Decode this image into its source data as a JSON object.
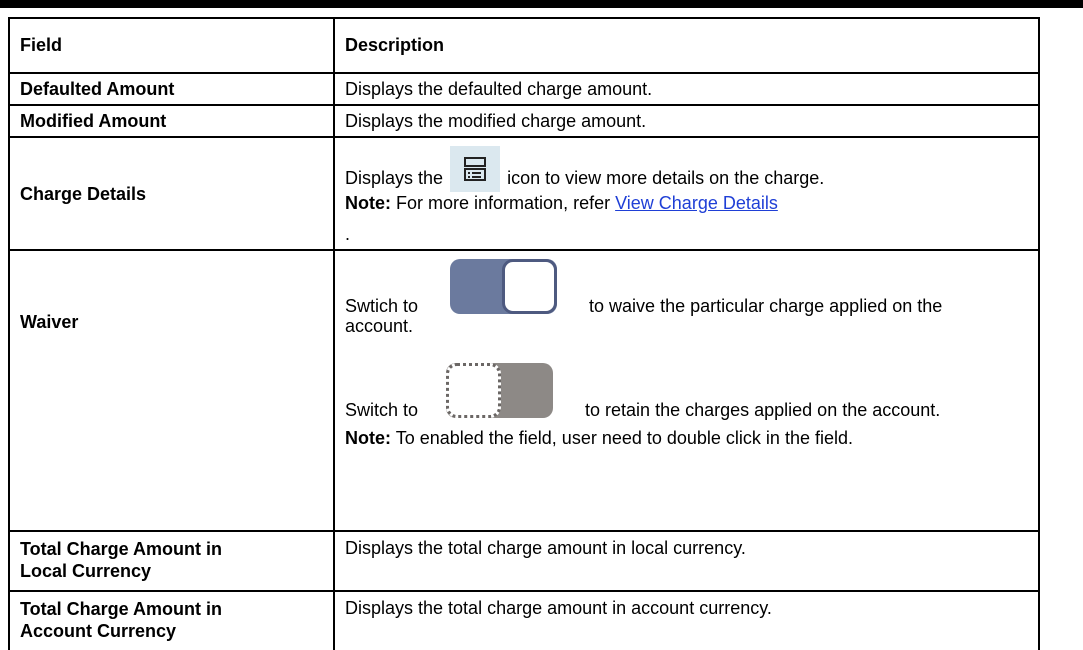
{
  "header": {
    "field": "Field",
    "description": "Description"
  },
  "rows": [
    {
      "field": "Defaulted Amount",
      "description": "Displays the defaulted charge amount."
    },
    {
      "field": "Modified Amount",
      "description": "Displays the modified charge amount."
    },
    {
      "field": "Charge Details",
      "desc_prefix": "Displays the",
      "desc_suffix": "icon to view more details on the charge.",
      "icon": "charge-details-icon",
      "note_label": "Note:",
      "note_text": "For more information, refer",
      "note_link": "View Charge Details",
      "trailing": "."
    },
    {
      "field": "Waiver",
      "on_prefix": "Swtich to",
      "on_suffix": "to waive the particular charge applied on the",
      "on_cont": "account.",
      "off_prefix": "Switch to",
      "off_suffix": "to retain the charges applied on the account.",
      "note_label": "Note:",
      "note_text": "To enabled the field, user need to double click in the field.",
      "toggle_on_color": "#6b7a9e",
      "toggle_off_color": "#8d8986"
    },
    {
      "field_l1": "Total Charge Amount in",
      "field_l2": "Local Currency",
      "description": "Displays the total charge amount in local currency."
    },
    {
      "field_l1": "Total Charge Amount in",
      "field_l2": "Account Currency",
      "description": "Displays the total charge amount in account currency."
    }
  ]
}
